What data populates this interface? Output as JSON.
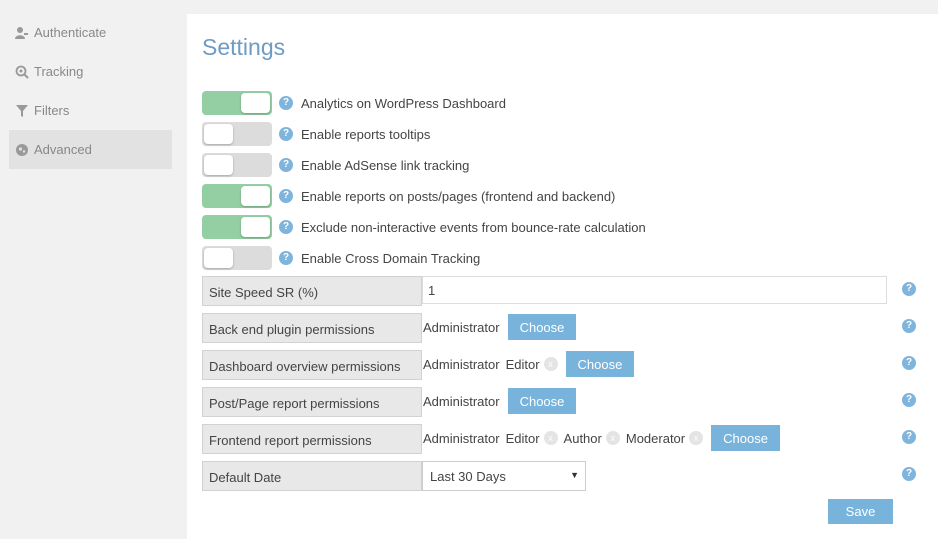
{
  "sidebar": {
    "items": [
      {
        "label": "Authenticate",
        "icon": "user-key-icon"
      },
      {
        "label": "Tracking",
        "icon": "magnifier-target-icon"
      },
      {
        "label": "Filters",
        "icon": "filter-funnel-icon"
      },
      {
        "label": "Advanced",
        "icon": "gears-icon",
        "active": true
      }
    ]
  },
  "main": {
    "title": "Settings",
    "help_symbol": "?",
    "remove_symbol": "x",
    "toggles": [
      {
        "label": "Analytics on WordPress Dashboard",
        "on": true
      },
      {
        "label": "Enable reports tooltips",
        "on": false
      },
      {
        "label": "Enable AdSense link tracking",
        "on": false
      },
      {
        "label": "Enable reports on posts/pages (frontend and backend)",
        "on": true
      },
      {
        "label": "Exclude non-interactive events from bounce-rate calculation",
        "on": true
      },
      {
        "label": "Enable Cross Domain Tracking",
        "on": false
      }
    ],
    "site_speed": {
      "label": "Site Speed SR (%)",
      "value": "1"
    },
    "permissions": [
      {
        "label": "Back end plugin permissions",
        "fixed": "Administrator",
        "roles": []
      },
      {
        "label": "Dashboard overview permissions",
        "fixed": "Administrator",
        "roles": [
          "Editor"
        ]
      },
      {
        "label": "Post/Page report permissions",
        "fixed": "Administrator",
        "roles": []
      },
      {
        "label": "Frontend report permissions",
        "fixed": "Administrator",
        "roles": [
          "Editor",
          "Author",
          "Moderator"
        ]
      }
    ],
    "choose_label": "Choose",
    "default_date": {
      "label": "Default Date",
      "value": "Last 30 Days",
      "caret": "▼"
    },
    "save_label": "Save"
  },
  "colors": {
    "accent": "#78b3dc",
    "title": "#6d9bc3",
    "toggle_on": "#94cfa4",
    "toggle_off": "#dcdcdc"
  }
}
